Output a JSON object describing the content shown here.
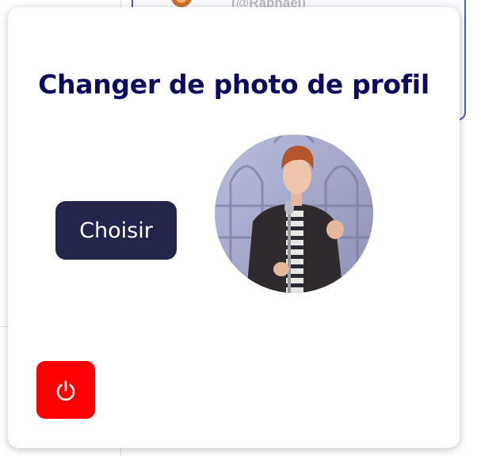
{
  "background": {
    "handle": "(@Raphael)"
  },
  "modal": {
    "title": "Changer de photo de profil",
    "choose_button_label": "Choisir",
    "avatar_icon": "profile-photo",
    "power_button_icon": "power-icon"
  },
  "colors": {
    "title": "#0c0c5e",
    "choose_button_bg": "#24254a",
    "power_button_bg": "#ff0000",
    "background_card_border": "#4a5bd6"
  }
}
